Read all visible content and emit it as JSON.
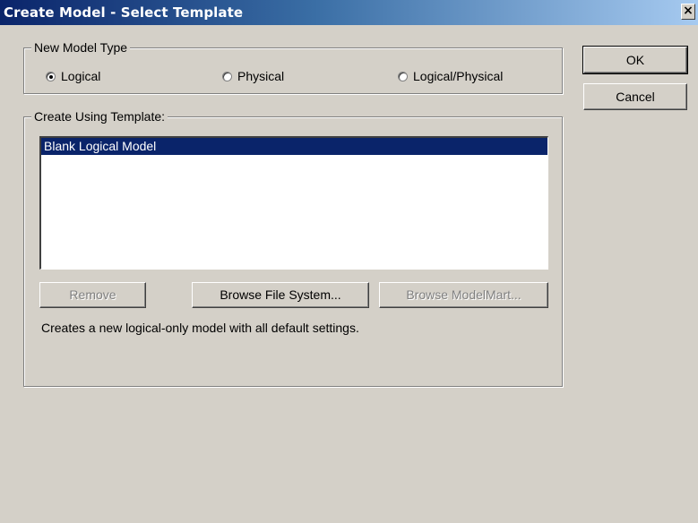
{
  "window": {
    "title": "Create Model - Select Template",
    "close_glyph": "×"
  },
  "model_type": {
    "legend": "New Model Type",
    "options": [
      {
        "label": "Logical",
        "checked": true
      },
      {
        "label": "Physical",
        "checked": false
      },
      {
        "label": "Logical/Physical",
        "checked": false
      }
    ]
  },
  "template": {
    "legend": "Create Using Template:",
    "items": [
      {
        "label": "Blank Logical Model",
        "selected": true
      }
    ],
    "buttons": {
      "remove": "Remove",
      "browse_fs": "Browse File System...",
      "browse_mm": "Browse ModelMart..."
    },
    "description": "Creates a new logical-only model with all default settings."
  },
  "actions": {
    "ok": "OK",
    "cancel": "Cancel"
  },
  "colors": {
    "face": "#d4d0c8",
    "title_start": "#0a246a",
    "title_end": "#a6caf0",
    "selection": "#0a246a"
  }
}
